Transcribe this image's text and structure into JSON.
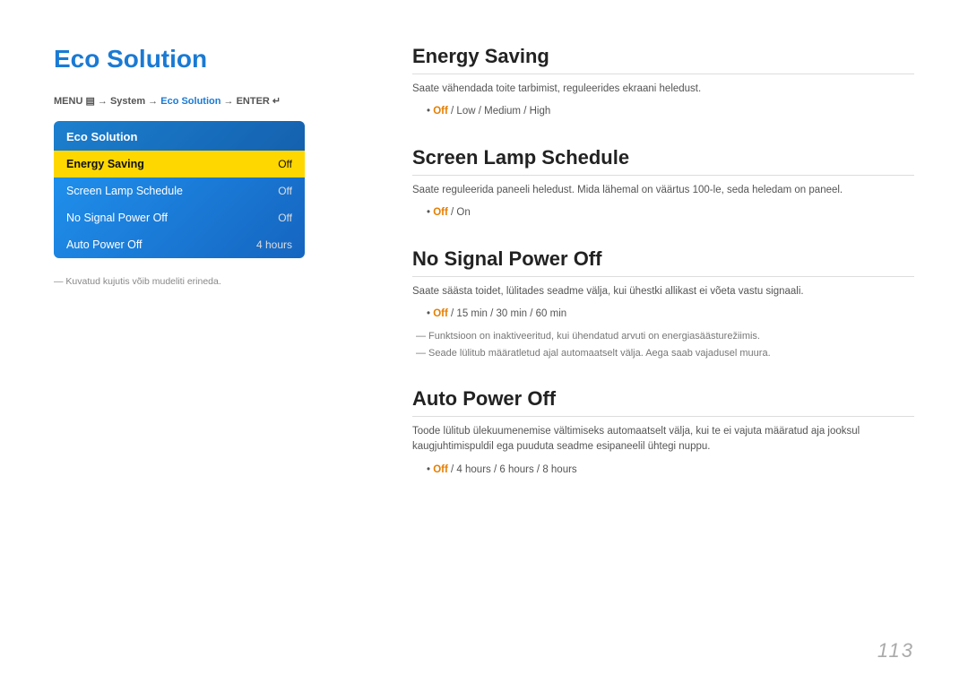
{
  "page": {
    "title": "Eco Solution",
    "page_number": "113"
  },
  "menu_path": {
    "text": "MENU",
    "arrow1": "→",
    "system": "System",
    "arrow2": "→",
    "eco_solution": "Eco Solution",
    "arrow3": "→",
    "enter": "ENTER"
  },
  "sidebar": {
    "title": "Eco Solution",
    "items": [
      {
        "label": "Energy Saving",
        "value": "Off",
        "active": true
      },
      {
        "label": "Screen Lamp Schedule",
        "value": "Off",
        "active": false
      },
      {
        "label": "No Signal Power Off",
        "value": "Off",
        "active": false
      },
      {
        "label": "Auto Power Off",
        "value": "4 hours",
        "active": false
      }
    ]
  },
  "footnote": "Kuvatud kujutis võib mudeliti erineda.",
  "sections": [
    {
      "id": "energy-saving",
      "title": "Energy Saving",
      "description": "Saate vähendada toite tarbimist, reguleerides ekraani heledust.",
      "options_prefix": "•",
      "options": "Off / Low / Medium / High",
      "options_highlight": "Off",
      "notes": []
    },
    {
      "id": "screen-lamp-schedule",
      "title": "Screen Lamp Schedule",
      "description": "Saate reguleerida paneeli heledust. Mida lähemal on väärtus 100-le, seda heledam on paneel.",
      "options_prefix": "•",
      "options": "Off / On",
      "options_highlight": "Off",
      "notes": []
    },
    {
      "id": "no-signal-power-off",
      "title": "No Signal Power Off",
      "description": "Saate säästa toidet, lülitades seadme välja, kui ühestki allikast ei võeta vastu signaali.",
      "options_prefix": "•",
      "options": "Off / 15 min / 30 min / 60 min",
      "options_highlight": "Off",
      "notes": [
        {
          "type": "dash",
          "text": "Funktsioon on inaktiveeritud, kui ühendatud arvuti on energiasäästurežiimis."
        },
        {
          "type": "dash",
          "text": "Seade lülitub määratletud ajal automaatselt välja. Aega saab vajadusel muura."
        }
      ]
    },
    {
      "id": "auto-power-off",
      "title": "Auto Power Off",
      "description": "Toode lülitub ülekuumenemise vältimiseks automaatselt välja, kui te ei vajuta määratud aja jooksul kaugjuhtimispuldil ega puuduta seadme esipaneelil ühtegi nuppu.",
      "options_prefix": "•",
      "options": "Off / 4 hours / 6 hours / 8 hours",
      "options_highlight": "Off",
      "notes": []
    }
  ]
}
